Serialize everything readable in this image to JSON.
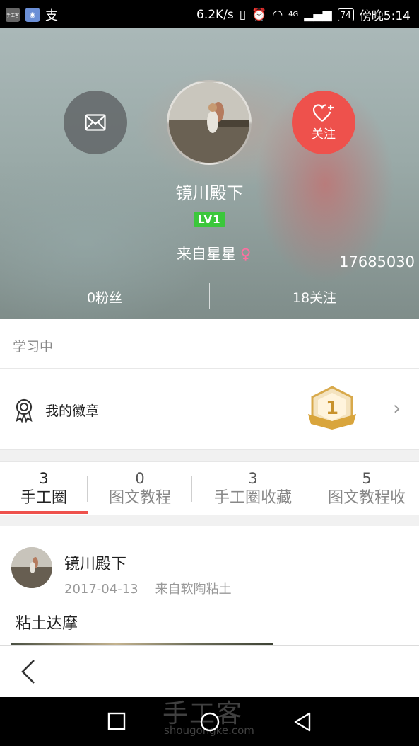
{
  "status_bar": {
    "app_icon_1": "手工客",
    "app_icon_2": "支",
    "speed": "6.2K/s",
    "network": "4G",
    "battery": "74",
    "time": "傍晚5:14"
  },
  "profile": {
    "username": "镜川殿下",
    "level": "LV1",
    "from": "来自星星",
    "gender_symbol": "♀",
    "user_id": "17685030",
    "fans": "0粉丝",
    "following": "18关注",
    "follow_label": "关注"
  },
  "status_text": "学习中",
  "badges": {
    "label": "我的徽章",
    "medal_number": "1"
  },
  "tabs": [
    {
      "count": "3",
      "label": "手工圈",
      "active": true
    },
    {
      "count": "0",
      "label": "图文教程"
    },
    {
      "count": "3",
      "label": "手工圈收藏"
    },
    {
      "count": "5",
      "label": "图文教程收"
    }
  ],
  "post": {
    "author": "镜川殿下",
    "date": "2017-04-13",
    "source": "来自软陶粘土",
    "title": "粘土达摩"
  },
  "watermark": {
    "logo": "手工客",
    "url": "shougongke.com"
  },
  "colors": {
    "accent": "#ee514c",
    "level_badge": "#3bc73b",
    "female": "#ff6fa0"
  }
}
